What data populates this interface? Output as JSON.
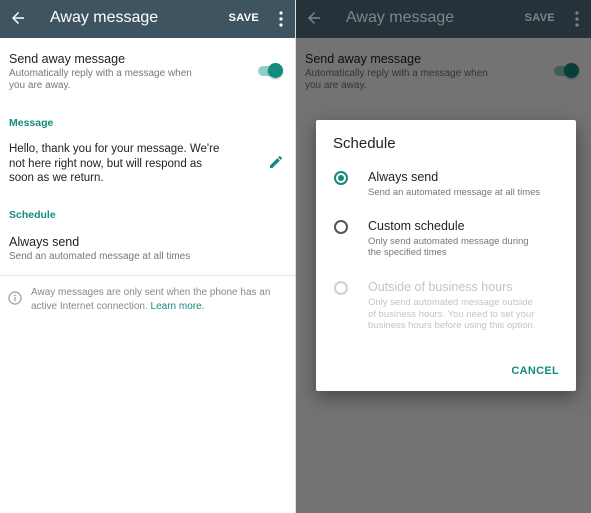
{
  "appbar": {
    "title": "Away message",
    "save_label": "SAVE"
  },
  "away": {
    "title": "Send away message",
    "subtitle_line1": "Automatically reply with a message when",
    "subtitle_line2": "you are away.",
    "enabled": true
  },
  "message": {
    "label": "Message",
    "line1": "Hello, thank you for your message. We're",
    "line2": "not here right now, but will respond as",
    "line3": "soon as we return."
  },
  "schedule": {
    "label": "Schedule",
    "value": "Always send",
    "value_sub": "Send an automated message at all times"
  },
  "info": {
    "line1": "Away messages are only sent when the phone has an",
    "line2_prefix": "active Internet connection. ",
    "link": "Learn more."
  },
  "dialog": {
    "title": "Schedule",
    "options": [
      {
        "label": "Always send",
        "sub": [
          "Send an automated message at all times"
        ],
        "selected": true,
        "disabled": false
      },
      {
        "label": "Custom schedule",
        "sub": [
          "Only send automated message during",
          "the specified times"
        ],
        "selected": false,
        "disabled": false
      },
      {
        "label": "Outside of business hours",
        "sub": [
          "Only send automated message outside",
          "of business hours. You need to set your",
          "business hours before using this option."
        ],
        "selected": false,
        "disabled": true
      }
    ],
    "cancel_label": "CANCEL"
  },
  "colors": {
    "accent": "#128c7e",
    "appbar": "#3e5460"
  },
  "icons": [
    "back-arrow-icon",
    "more-vert-icon",
    "pencil-icon",
    "info-icon"
  ]
}
